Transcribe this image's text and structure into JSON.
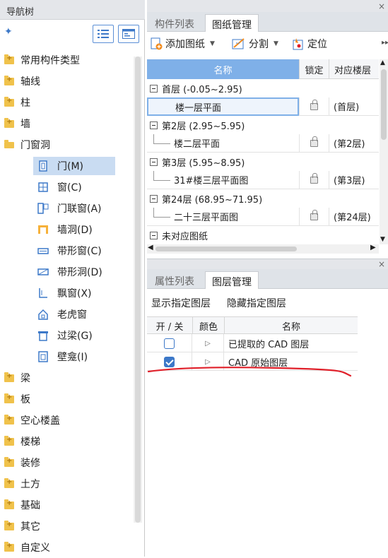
{
  "nav": {
    "title": "导航树",
    "tree": [
      {
        "label": "常用构件类型",
        "type": "folder"
      },
      {
        "label": "轴线",
        "type": "folder"
      },
      {
        "label": "柱",
        "type": "folder"
      },
      {
        "label": "墙",
        "type": "folder"
      },
      {
        "label": "门窗洞",
        "type": "folder-open"
      },
      {
        "label": "门(M)",
        "type": "child",
        "selected": true,
        "icon": "door-icon"
      },
      {
        "label": "窗(C)",
        "type": "child",
        "icon": "window-icon"
      },
      {
        "label": "门联窗(A)",
        "type": "child",
        "icon": "door-window-icon"
      },
      {
        "label": "墙洞(D)",
        "type": "child",
        "icon": "wall-opening-icon"
      },
      {
        "label": "带形窗(C)",
        "type": "child",
        "icon": "strip-window-icon"
      },
      {
        "label": "带形洞(D)",
        "type": "child",
        "icon": "strip-opening-icon"
      },
      {
        "label": "飘窗(X)",
        "type": "child",
        "icon": "bay-window-icon"
      },
      {
        "label": "老虎窗",
        "type": "child",
        "icon": "dormer-icon"
      },
      {
        "label": "过梁(G)",
        "type": "child",
        "icon": "lintel-icon"
      },
      {
        "label": "壁龛(I)",
        "type": "child",
        "icon": "niche-icon"
      },
      {
        "label": "梁",
        "type": "folder"
      },
      {
        "label": "板",
        "type": "folder"
      },
      {
        "label": "空心楼盖",
        "type": "folder"
      },
      {
        "label": "楼梯",
        "type": "folder"
      },
      {
        "label": "装修",
        "type": "folder"
      },
      {
        "label": "土方",
        "type": "folder"
      },
      {
        "label": "基础",
        "type": "folder"
      },
      {
        "label": "其它",
        "type": "folder"
      },
      {
        "label": "自定义",
        "type": "folder"
      }
    ]
  },
  "drawings": {
    "tabs": [
      "构件列表",
      "图纸管理"
    ],
    "toolbar": {
      "add": "添加图纸",
      "split": "分割",
      "locate": "定位"
    },
    "columns": [
      "名称",
      "锁定",
      "对应楼层"
    ],
    "rows": [
      {
        "kind": "floor",
        "name": "首层 (-0.05~2.95)"
      },
      {
        "kind": "sheet",
        "name": "楼一层平面",
        "floor": "(首层)",
        "selected": true
      },
      {
        "kind": "floor",
        "name": "第2层 (2.95~5.95)"
      },
      {
        "kind": "sheet",
        "name": "楼二层平面",
        "floor": "(第2层)"
      },
      {
        "kind": "floor",
        "name": "第3层 (5.95~8.95)"
      },
      {
        "kind": "sheet",
        "name": "31#楼三层平面图",
        "floor": "(第3层)"
      },
      {
        "kind": "floor",
        "name": "第24层 (68.95~71.95)"
      },
      {
        "kind": "sheet",
        "name": "二十三层平面图",
        "floor": "(第24层)"
      },
      {
        "kind": "floor",
        "name": "未对应图纸"
      }
    ]
  },
  "layers": {
    "tabs": [
      "属性列表",
      "图层管理"
    ],
    "actions": {
      "show": "显示指定图层",
      "hide": "隐藏指定图层"
    },
    "columns": [
      "开 / 关",
      "颜色",
      "名称"
    ],
    "rows": [
      {
        "checked": false,
        "name": "已提取的 CAD 图层"
      },
      {
        "checked": true,
        "name": "CAD 原始图层"
      }
    ]
  },
  "colors": {
    "accent": "#3c78c8",
    "header_blue": "#7fb0e8",
    "annotation_red": "#e0202a"
  }
}
